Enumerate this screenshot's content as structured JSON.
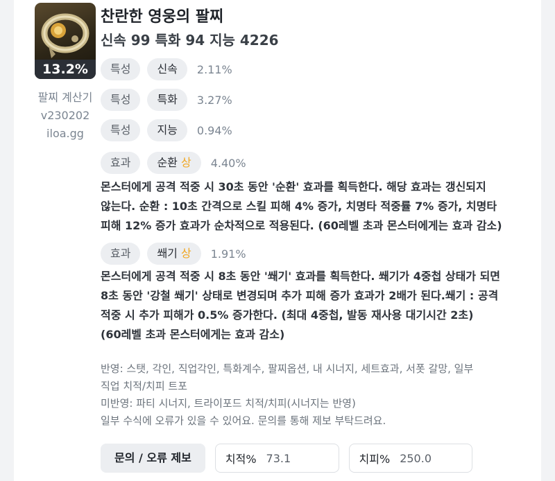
{
  "item": {
    "name": "찬란한 영웅의 팔찌",
    "stats_line": "신속 99  특화 94  지능 4226",
    "percent": "13.2%"
  },
  "app": {
    "line1": "팔찌 계산기",
    "line2": "v230202",
    "line3": "iloa.gg"
  },
  "rows": [
    {
      "tag": "특성",
      "name": "신속",
      "grade": "",
      "value": "2.11%"
    },
    {
      "tag": "특성",
      "name": "특화",
      "grade": "",
      "value": "3.27%"
    },
    {
      "tag": "특성",
      "name": "지능",
      "grade": "",
      "value": "0.94%"
    },
    {
      "tag": "효과",
      "name": "순환",
      "grade": "상",
      "value": "4.40%"
    },
    {
      "tag": "효과",
      "name": "쐐기",
      "grade": "상",
      "value": "1.91%"
    }
  ],
  "effects": [
    {
      "lines": [
        "몬스터에게 공격 적중 시 30초 동안 '순환' 효과를 획득한다. 해당 효과는 갱신되지",
        "않는다. 순환 : 10초 간격으로 스킬 피해 4% 증가, 치명타 적중률 7% 증가, 치명타",
        "피해 12% 증가 효과가 순차적으로 적용된다. (60레벨 초과 몬스터에게는 효과 감소)"
      ]
    },
    {
      "lines": [
        "몬스터에게 공격 적중 시 8초 동안 '쐐기' 효과를 획득한다. 쐐기가 4중첩 상태가 되면",
        "8초 동안 '강철 쐐기' 상태로 변경되며 추가 피해 증가 효과가 2배가 된다.쐐기 : 공격",
        "적중 시 추가 피해가 0.5% 증가한다. (최대 4중첩, 발동 재사용 대기시간 2초)",
        "(60레벨 초과 몬스터에게는 효과 감소)"
      ]
    }
  ],
  "notes": [
    "반영: 스탯, 각인, 직업각인, 특화계수, 팔찌옵션, 내 시너지, 세트효과, 서폿 갈망, 일부",
    "직업 치적/치피 트포",
    "미반영: 파티 시너지, 트라이포드 치적/치피(시너지는 반영)",
    "일부 수식에 오류가 있을 수 있어요. 문의를 통해 제보 부탁드려요."
  ],
  "footer": {
    "report_button": "문의 / 오류 제보",
    "crit_rate_label": "치적%",
    "crit_rate_value": "73.1",
    "crit_dmg_label": "치피%",
    "crit_dmg_value": "250.0"
  },
  "colors": {
    "grade_high": "#f0a825",
    "badge_bg": "#2b2f36"
  },
  "icons": {
    "item": "bracelet-item-icon"
  }
}
